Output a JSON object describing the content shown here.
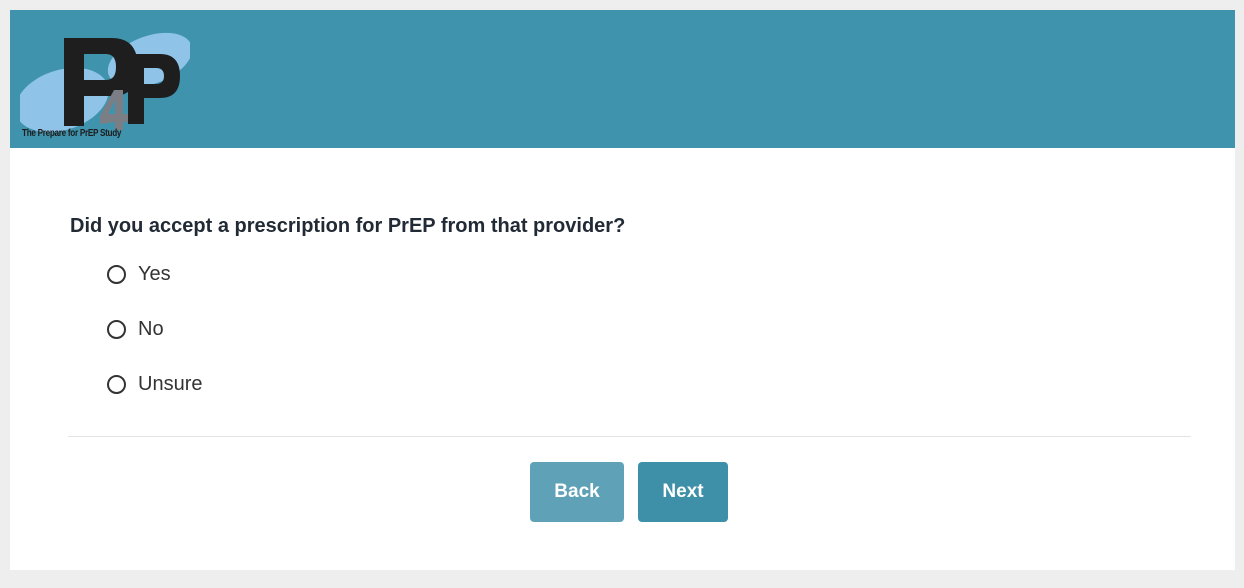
{
  "header": {
    "background_color": "#3f93ad",
    "logo": {
      "mark": "P4P",
      "caption": "The Prepare for PrEP Study"
    }
  },
  "form": {
    "question": "Did you accept a prescription for PrEP from that provider?",
    "options": [
      {
        "label": "Yes",
        "selected": false
      },
      {
        "label": "No",
        "selected": false
      },
      {
        "label": "Unsure",
        "selected": false
      }
    ]
  },
  "nav": {
    "back_label": "Back",
    "next_label": "Next",
    "back_color": "#5fa1b7",
    "next_color": "#3e8fa8"
  }
}
